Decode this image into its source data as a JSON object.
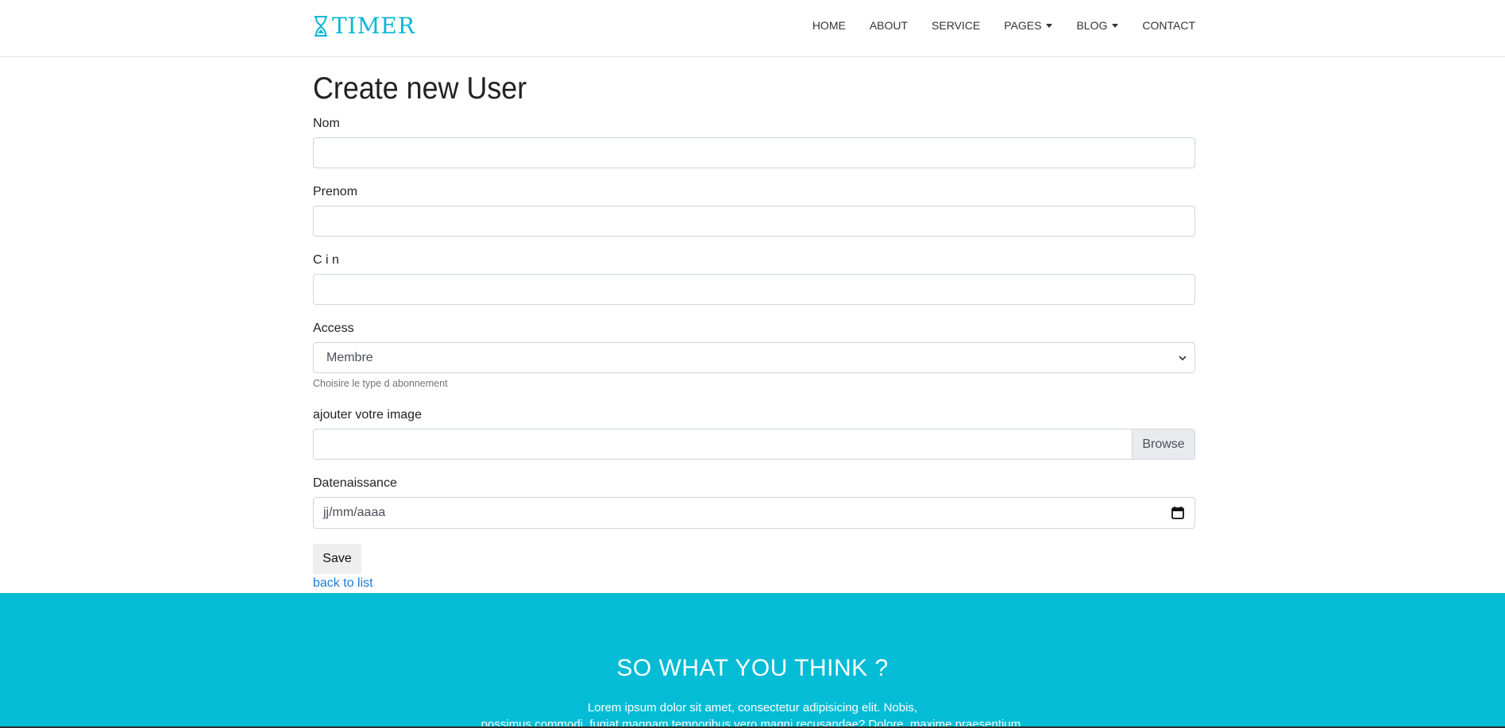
{
  "brand": {
    "name": "TIMER",
    "icon": "hourglass-icon",
    "color": "#04b7d4"
  },
  "nav": {
    "items": [
      {
        "label": "HOME"
      },
      {
        "label": "ABOUT"
      },
      {
        "label": "SERVICE"
      },
      {
        "label": "PAGES",
        "dropdown": true
      },
      {
        "label": "BLOG",
        "dropdown": true
      },
      {
        "label": "CONTACT"
      }
    ]
  },
  "form": {
    "title": "Create new User",
    "nom_label": "Nom",
    "nom_value": "",
    "prenom_label": "Prenom",
    "prenom_value": "",
    "cin_label": "C i n",
    "cin_value": "",
    "access_label": "Access",
    "access_selected": "Membre",
    "access_help": "Choisire le type d abonnement",
    "image_label": "ajouter votre image",
    "browse_label": "Browse",
    "date_label": "Datenaissance",
    "date_placeholder": "jj/mm/aaaa",
    "save_label": "Save",
    "back_label": "back to list"
  },
  "footer": {
    "title": "SO WHAT YOU THINK ?",
    "line1": "Lorem ipsum dolor sit amet, consectetur adipisicing elit. Nobis,",
    "line2": "possimus commodi, fugiat magnam temporibus vero magni recusandae? Dolore, maxime praesentium.",
    "background": "#04bcd6"
  },
  "colors": {
    "accent": "#04bcd6",
    "link": "#1e7bd6"
  }
}
